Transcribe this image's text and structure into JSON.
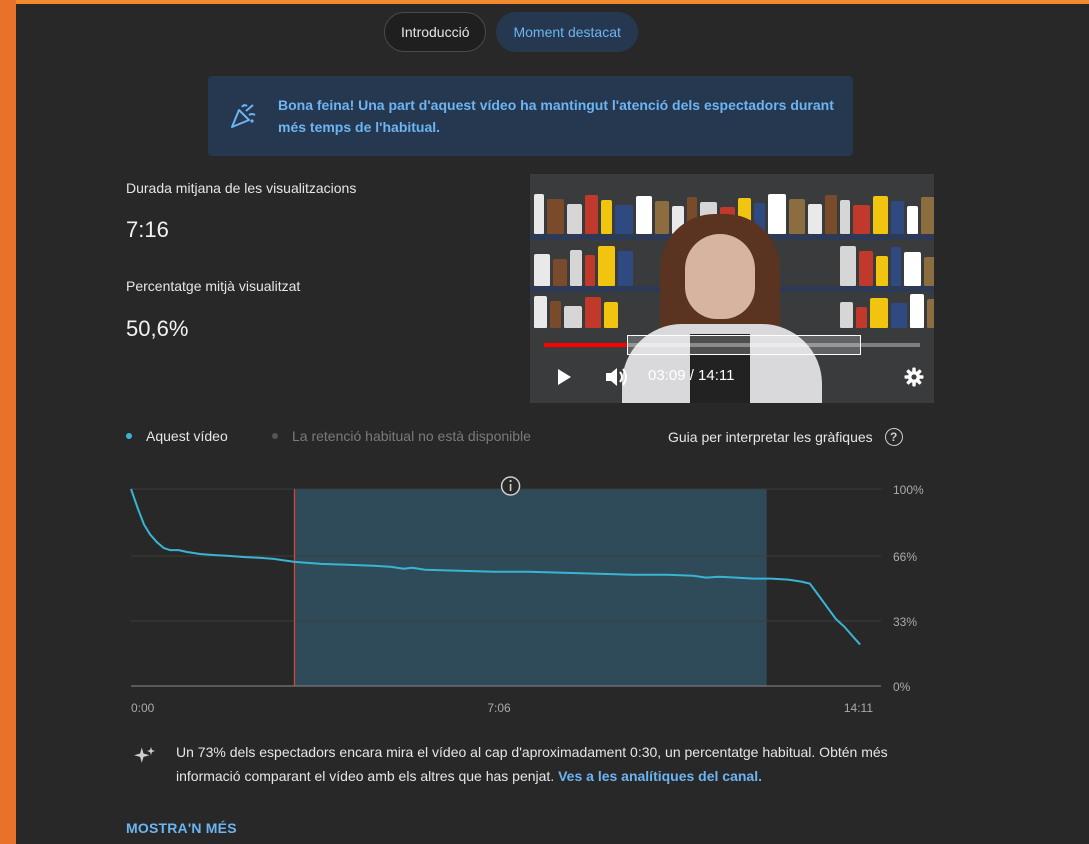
{
  "tabs": [
    {
      "label": "Introducció",
      "active": false
    },
    {
      "label": "Moment destacat",
      "active": true
    }
  ],
  "banner": {
    "icon": "party-popper-icon",
    "text": "Bona feina! Una part d'aquest vídeo ha mantingut l'atenció dels espectadors durant més temps de l'habitual."
  },
  "stats": {
    "avg_duration_label": "Durada mitjana de les visualitzacions",
    "avg_duration_value": "7:16",
    "avg_percent_label": "Percentatge mitjà visualitzat",
    "avg_percent_value": "50,6%"
  },
  "player": {
    "time_display": "03:09 / 14:11",
    "position_fraction": 0.222,
    "icons": [
      "play-icon",
      "volume-icon",
      "settings-icon"
    ]
  },
  "legend": {
    "this_video": "Aquest vídeo",
    "typical": "La retenció habitual no està disponible",
    "guide_link": "Guia per interpretar les gràfiques",
    "guide_icon": "help-circle-icon"
  },
  "colors": {
    "accent_blue": "#6cb4f2",
    "series_line": "#3ab4d4",
    "highlight_band": "#2f4a58",
    "cursor_line": "#e0443a"
  },
  "chart_data": {
    "type": "line",
    "title": "",
    "xlabel": "",
    "ylabel": "",
    "x_tick_labels": [
      "0:00",
      "7:06",
      "14:11"
    ],
    "y_tick_labels": [
      "100%",
      "66%",
      "33%",
      "0%"
    ],
    "y_ticks": [
      100,
      66,
      33,
      0
    ],
    "xlim_seconds": [
      0,
      851
    ],
    "ylim": [
      0,
      100
    ],
    "highlight_range_seconds": [
      189,
      735
    ],
    "cursor_seconds": 189,
    "series": [
      {
        "name": "Aquest vídeo",
        "x_seconds": [
          0,
          8,
          15,
          22,
          30,
          38,
          45,
          55,
          65,
          80,
          95,
          115,
          130,
          150,
          165,
          189,
          220,
          250,
          280,
          300,
          315,
          325,
          340,
          380,
          420,
          460,
          500,
          540,
          580,
          620,
          650,
          665,
          680,
          700,
          720,
          740,
          760,
          775,
          785,
          795,
          805,
          815,
          825,
          835,
          843
        ],
        "values": [
          100,
          90,
          82,
          77,
          73,
          70,
          69,
          69,
          68,
          67,
          66.5,
          66,
          65.5,
          65,
          64.5,
          63,
          62,
          61.5,
          61,
          60.5,
          59.5,
          60,
          59,
          58.5,
          58,
          58,
          57.5,
          57,
          56.5,
          56.5,
          56,
          55,
          55.5,
          55,
          54.5,
          54.5,
          54,
          53,
          52,
          46,
          40,
          34,
          30,
          25,
          21
        ]
      }
    ],
    "info_icon": "info-icon"
  },
  "insight": {
    "icon": "sparkle-icon",
    "text": "Un 73% dels espectadors encara mira el vídeo al cap d'aproximadament 0:30, un percentatge habitual. Obtén més informació comparant el vídeo amb els altres que has penjat.",
    "link": "Ves a les analítiques del canal."
  },
  "show_more": "MOSTRA'N MÉS"
}
